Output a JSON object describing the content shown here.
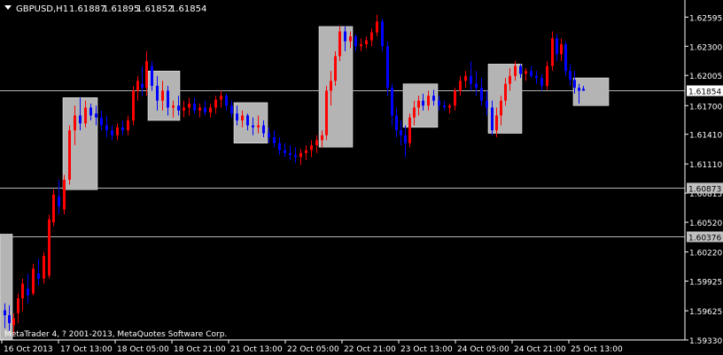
{
  "chart_data": {
    "type": "candlestick",
    "symbol_timeframe": "GBPUSD,H1",
    "ohlc_header": {
      "open": "1.61887",
      "high": "1.61895",
      "low": "1.61852",
      "close": "1.61854"
    },
    "watermark": "MetaTrader 4, ? 2001-2013, MetaQuotes Software Corp.",
    "ylim": [
      1.5933,
      1.6275
    ],
    "y_ticks": [
      "1.62595",
      "1.62300",
      "1.62005",
      "1.61700",
      "1.61410",
      "1.61110",
      "1.60815",
      "1.60520",
      "1.60220",
      "1.59925",
      "1.59625",
      "1.59330"
    ],
    "x_ticks": [
      "16 Oct 2013",
      "17 Oct 13:00",
      "18 Oct 05:00",
      "18 Oct 21:00",
      "21 Oct 13:00",
      "22 Oct 05:00",
      "22 Oct 21:00",
      "23 Oct 13:00",
      "24 Oct 05:00",
      "24 Oct 21:00",
      "25 Oct 13:00"
    ],
    "horizontal_lines": [
      {
        "price": 1.61854,
        "label": "1.61854",
        "kind": "bid"
      },
      {
        "price": 1.60873,
        "label": "1.60873",
        "kind": "level"
      },
      {
        "price": 1.60376,
        "label": "1.60376",
        "kind": "level"
      }
    ],
    "candles": [
      {
        "i": 0,
        "o": 1.5963,
        "h": 1.597,
        "l": 1.5945,
        "c": 1.5958
      },
      {
        "i": 5,
        "o": 1.5958,
        "h": 1.5968,
        "l": 1.5942,
        "c": 1.595
      },
      {
        "i": 10,
        "o": 1.5948,
        "h": 1.596,
        "l": 1.5938,
        "c": 1.5955
      },
      {
        "i": 15,
        "o": 1.596,
        "h": 1.598,
        "l": 1.595,
        "c": 1.5975
      },
      {
        "i": 20,
        "o": 1.5975,
        "h": 1.5995,
        "l": 1.5962,
        "c": 1.599
      },
      {
        "i": 26,
        "o": 1.5985,
        "h": 1.6,
        "l": 1.597,
        "c": 1.5978
      },
      {
        "i": 32,
        "o": 1.598,
        "h": 1.601,
        "l": 1.5978,
        "c": 1.6005
      },
      {
        "i": 38,
        "o": 1.6,
        "h": 1.6015,
        "l": 1.5988,
        "c": 1.5995
      },
      {
        "i": 44,
        "o": 1.5995,
        "h": 1.6022,
        "l": 1.599,
        "c": 1.6018
      },
      {
        "i": 50,
        "o": 1.5998,
        "h": 1.606,
        "l": 1.5995,
        "c": 1.6055
      },
      {
        "i": 55,
        "o": 1.6052,
        "h": 1.6085,
        "l": 1.6048,
        "c": 1.608
      },
      {
        "i": 61,
        "o": 1.6078,
        "h": 1.6095,
        "l": 1.606,
        "c": 1.6068
      },
      {
        "i": 67,
        "o": 1.6065,
        "h": 1.61,
        "l": 1.606,
        "c": 1.6095
      },
      {
        "i": 73,
        "o": 1.6095,
        "h": 1.615,
        "l": 1.609,
        "c": 1.6145
      },
      {
        "i": 79,
        "o": 1.6145,
        "h": 1.617,
        "l": 1.613,
        "c": 1.616
      },
      {
        "i": 85,
        "o": 1.616,
        "h": 1.6178,
        "l": 1.6145,
        "c": 1.6152
      },
      {
        "i": 91,
        "o": 1.6152,
        "h": 1.6175,
        "l": 1.6148,
        "c": 1.6168
      },
      {
        "i": 97,
        "o": 1.6168,
        "h": 1.6172,
        "l": 1.6155,
        "c": 1.616
      },
      {
        "i": 103,
        "o": 1.6162,
        "h": 1.617,
        "l": 1.615,
        "c": 1.6158
      },
      {
        "i": 109,
        "o": 1.6158,
        "h": 1.6165,
        "l": 1.6145,
        "c": 1.615
      },
      {
        "i": 115,
        "o": 1.615,
        "h": 1.616,
        "l": 1.6138,
        "c": 1.6145
      },
      {
        "i": 121,
        "o": 1.6145,
        "h": 1.615,
        "l": 1.6135,
        "c": 1.614
      },
      {
        "i": 127,
        "o": 1.614,
        "h": 1.6152,
        "l": 1.6135,
        "c": 1.6148
      },
      {
        "i": 133,
        "o": 1.6148,
        "h": 1.6155,
        "l": 1.614,
        "c": 1.6145
      },
      {
        "i": 139,
        "o": 1.6145,
        "h": 1.616,
        "l": 1.614,
        "c": 1.6155
      },
      {
        "i": 145,
        "o": 1.6155,
        "h": 1.619,
        "l": 1.615,
        "c": 1.6185
      },
      {
        "i": 150,
        "o": 1.6185,
        "h": 1.62,
        "l": 1.6175,
        "c": 1.6195
      },
      {
        "i": 155,
        "o": 1.6192,
        "h": 1.621,
        "l": 1.618,
        "c": 1.6188
      },
      {
        "i": 160,
        "o": 1.6188,
        "h": 1.6225,
        "l": 1.618,
        "c": 1.6215
      },
      {
        "i": 166,
        "o": 1.621,
        "h": 1.6215,
        "l": 1.6185,
        "c": 1.619
      },
      {
        "i": 172,
        "o": 1.619,
        "h": 1.62,
        "l": 1.6165,
        "c": 1.6175
      },
      {
        "i": 178,
        "o": 1.6175,
        "h": 1.6195,
        "l": 1.6165,
        "c": 1.6185
      },
      {
        "i": 184,
        "o": 1.6185,
        "h": 1.619,
        "l": 1.616,
        "c": 1.6168
      },
      {
        "i": 190,
        "o": 1.6168,
        "h": 1.6175,
        "l": 1.6158,
        "c": 1.617
      },
      {
        "i": 196,
        "o": 1.617,
        "h": 1.618,
        "l": 1.616,
        "c": 1.6165
      },
      {
        "i": 202,
        "o": 1.6165,
        "h": 1.6175,
        "l": 1.6158,
        "c": 1.6168
      },
      {
        "i": 208,
        "o": 1.6168,
        "h": 1.6178,
        "l": 1.616,
        "c": 1.6172
      },
      {
        "i": 214,
        "o": 1.6172,
        "h": 1.6178,
        "l": 1.6162,
        "c": 1.6165
      },
      {
        "i": 220,
        "o": 1.6165,
        "h": 1.6172,
        "l": 1.6158,
        "c": 1.6168
      },
      {
        "i": 226,
        "o": 1.6168,
        "h": 1.6175,
        "l": 1.616,
        "c": 1.6163
      },
      {
        "i": 232,
        "o": 1.6163,
        "h": 1.6172,
        "l": 1.6158,
        "c": 1.6168
      },
      {
        "i": 238,
        "o": 1.6168,
        "h": 1.618,
        "l": 1.6162,
        "c": 1.6176
      },
      {
        "i": 244,
        "o": 1.6176,
        "h": 1.6185,
        "l": 1.6168,
        "c": 1.618
      },
      {
        "i": 250,
        "o": 1.618,
        "h": 1.6182,
        "l": 1.6165,
        "c": 1.617
      },
      {
        "i": 256,
        "o": 1.617,
        "h": 1.6175,
        "l": 1.6158,
        "c": 1.6162
      },
      {
        "i": 262,
        "o": 1.6162,
        "h": 1.617,
        "l": 1.615,
        "c": 1.6155
      },
      {
        "i": 268,
        "o": 1.6155,
        "h": 1.6165,
        "l": 1.6148,
        "c": 1.616
      },
      {
        "i": 274,
        "o": 1.616,
        "h": 1.6162,
        "l": 1.6145,
        "c": 1.615
      },
      {
        "i": 280,
        "o": 1.615,
        "h": 1.6158,
        "l": 1.614,
        "c": 1.6148
      },
      {
        "i": 286,
        "o": 1.6148,
        "h": 1.616,
        "l": 1.6142,
        "c": 1.615
      },
      {
        "i": 292,
        "o": 1.615,
        "h": 1.6155,
        "l": 1.6138,
        "c": 1.6142
      },
      {
        "i": 298,
        "o": 1.6142,
        "h": 1.6148,
        "l": 1.6132,
        "c": 1.6138
      },
      {
        "i": 304,
        "o": 1.6138,
        "h": 1.6145,
        "l": 1.6128,
        "c": 1.6132
      },
      {
        "i": 310,
        "o": 1.6132,
        "h": 1.6138,
        "l": 1.612,
        "c": 1.6125
      },
      {
        "i": 316,
        "o": 1.6125,
        "h": 1.6132,
        "l": 1.6118,
        "c": 1.6122
      },
      {
        "i": 322,
        "o": 1.6122,
        "h": 1.613,
        "l": 1.6115,
        "c": 1.612
      },
      {
        "i": 328,
        "o": 1.612,
        "h": 1.6128,
        "l": 1.6112,
        "c": 1.6118
      },
      {
        "i": 334,
        "o": 1.6118,
        "h": 1.6126,
        "l": 1.611,
        "c": 1.6122
      },
      {
        "i": 340,
        "o": 1.6122,
        "h": 1.613,
        "l": 1.6115,
        "c": 1.6125
      },
      {
        "i": 346,
        "o": 1.6125,
        "h": 1.6135,
        "l": 1.6118,
        "c": 1.613
      },
      {
        "i": 352,
        "o": 1.613,
        "h": 1.614,
        "l": 1.6122,
        "c": 1.6135
      },
      {
        "i": 358,
        "o": 1.6135,
        "h": 1.6145,
        "l": 1.6128,
        "c": 1.614
      },
      {
        "i": 363,
        "o": 1.614,
        "h": 1.619,
        "l": 1.6135,
        "c": 1.6185
      },
      {
        "i": 368,
        "o": 1.6185,
        "h": 1.6205,
        "l": 1.617,
        "c": 1.6195
      },
      {
        "i": 373,
        "o": 1.6195,
        "h": 1.6225,
        "l": 1.619,
        "c": 1.622
      },
      {
        "i": 378,
        "o": 1.622,
        "h": 1.625,
        "l": 1.6215,
        "c": 1.6245
      },
      {
        "i": 384,
        "o": 1.6245,
        "h": 1.625,
        "l": 1.6225,
        "c": 1.6235
      },
      {
        "i": 390,
        "o": 1.6235,
        "h": 1.6245,
        "l": 1.6228,
        "c": 1.624
      },
      {
        "i": 396,
        "o": 1.624,
        "h": 1.6242,
        "l": 1.6225,
        "c": 1.623
      },
      {
        "i": 402,
        "o": 1.623,
        "h": 1.6238,
        "l": 1.6225,
        "c": 1.6232
      },
      {
        "i": 408,
        "o": 1.6232,
        "h": 1.624,
        "l": 1.6228,
        "c": 1.6236
      },
      {
        "i": 414,
        "o": 1.6236,
        "h": 1.6248,
        "l": 1.623,
        "c": 1.6244
      },
      {
        "i": 420,
        "o": 1.6244,
        "h": 1.6262,
        "l": 1.624,
        "c": 1.6255
      },
      {
        "i": 426,
        "o": 1.6255,
        "h": 1.6258,
        "l": 1.6225,
        "c": 1.623
      },
      {
        "i": 432,
        "o": 1.623,
        "h": 1.6235,
        "l": 1.618,
        "c": 1.6188
      },
      {
        "i": 437,
        "o": 1.6188,
        "h": 1.6192,
        "l": 1.615,
        "c": 1.616
      },
      {
        "i": 442,
        "o": 1.616,
        "h": 1.6168,
        "l": 1.6138,
        "c": 1.6145
      },
      {
        "i": 447,
        "o": 1.6145,
        "h": 1.6155,
        "l": 1.613,
        "c": 1.614
      },
      {
        "i": 452,
        "o": 1.614,
        "h": 1.615,
        "l": 1.6118,
        "c": 1.6132
      },
      {
        "i": 457,
        "o": 1.6132,
        "h": 1.6162,
        "l": 1.6128,
        "c": 1.6158
      },
      {
        "i": 462,
        "o": 1.6158,
        "h": 1.6175,
        "l": 1.615,
        "c": 1.6168
      },
      {
        "i": 467,
        "o": 1.6168,
        "h": 1.618,
        "l": 1.616,
        "c": 1.6175
      },
      {
        "i": 472,
        "o": 1.6175,
        "h": 1.6182,
        "l": 1.6165,
        "c": 1.617
      },
      {
        "i": 478,
        "o": 1.617,
        "h": 1.6185,
        "l": 1.6165,
        "c": 1.618
      },
      {
        "i": 484,
        "o": 1.618,
        "h": 1.6186,
        "l": 1.617,
        "c": 1.6175
      },
      {
        "i": 490,
        "o": 1.6175,
        "h": 1.618,
        "l": 1.6165,
        "c": 1.617
      },
      {
        "i": 496,
        "o": 1.617,
        "h": 1.6175,
        "l": 1.6165,
        "c": 1.6168
      },
      {
        "i": 502,
        "o": 1.6168,
        "h": 1.6172,
        "l": 1.6162,
        "c": 1.617
      },
      {
        "i": 508,
        "o": 1.617,
        "h": 1.6188,
        "l": 1.6165,
        "c": 1.6185
      },
      {
        "i": 514,
        "o": 1.6185,
        "h": 1.62,
        "l": 1.618,
        "c": 1.6195
      },
      {
        "i": 520,
        "o": 1.6195,
        "h": 1.6205,
        "l": 1.6188,
        "c": 1.62
      },
      {
        "i": 526,
        "o": 1.62,
        "h": 1.6215,
        "l": 1.6185,
        "c": 1.6192
      },
      {
        "i": 532,
        "o": 1.6192,
        "h": 1.6205,
        "l": 1.618,
        "c": 1.6188
      },
      {
        "i": 538,
        "o": 1.6188,
        "h": 1.6198,
        "l": 1.617,
        "c": 1.6175
      },
      {
        "i": 544,
        "o": 1.6175,
        "h": 1.6185,
        "l": 1.616,
        "c": 1.6168
      },
      {
        "i": 550,
        "o": 1.6168,
        "h": 1.6175,
        "l": 1.614,
        "c": 1.6145
      },
      {
        "i": 555,
        "o": 1.6145,
        "h": 1.6168,
        "l": 1.6138,
        "c": 1.616
      },
      {
        "i": 560,
        "o": 1.616,
        "h": 1.618,
        "l": 1.615,
        "c": 1.6175
      },
      {
        "i": 565,
        "o": 1.6175,
        "h": 1.6198,
        "l": 1.617,
        "c": 1.6192
      },
      {
        "i": 570,
        "o": 1.6192,
        "h": 1.6208,
        "l": 1.6185,
        "c": 1.62
      },
      {
        "i": 576,
        "o": 1.62,
        "h": 1.6215,
        "l": 1.6195,
        "c": 1.621
      },
      {
        "i": 582,
        "o": 1.621,
        "h": 1.6212,
        "l": 1.6198,
        "c": 1.6202
      },
      {
        "i": 588,
        "o": 1.6202,
        "h": 1.6208,
        "l": 1.6195,
        "c": 1.6205
      },
      {
        "i": 594,
        "o": 1.6205,
        "h": 1.621,
        "l": 1.6198,
        "c": 1.62
      },
      {
        "i": 600,
        "o": 1.62,
        "h": 1.6205,
        "l": 1.6192,
        "c": 1.6198
      },
      {
        "i": 606,
        "o": 1.6198,
        "h": 1.6202,
        "l": 1.6185,
        "c": 1.619
      },
      {
        "i": 612,
        "o": 1.619,
        "h": 1.6215,
        "l": 1.6186,
        "c": 1.621
      },
      {
        "i": 618,
        "o": 1.621,
        "h": 1.6245,
        "l": 1.6205,
        "c": 1.6238
      },
      {
        "i": 623,
        "o": 1.6238,
        "h": 1.6242,
        "l": 1.6215,
        "c": 1.6222
      },
      {
        "i": 628,
        "o": 1.6222,
        "h": 1.6238,
        "l": 1.6215,
        "c": 1.6232
      },
      {
        "i": 633,
        "o": 1.6232,
        "h": 1.6235,
        "l": 1.62,
        "c": 1.6205
      },
      {
        "i": 638,
        "o": 1.6205,
        "h": 1.6212,
        "l": 1.619,
        "c": 1.6196
      },
      {
        "i": 643,
        "o": 1.6196,
        "h": 1.6205,
        "l": 1.6182,
        "c": 1.6188
      },
      {
        "i": 648,
        "o": 1.6188,
        "h": 1.6192,
        "l": 1.6172,
        "c": 1.6185
      },
      {
        "i": 653,
        "o": 1.6187,
        "h": 1.619,
        "l": 1.6185,
        "c": 1.6185
      }
    ],
    "boxes": [
      {
        "x0": 0,
        "x1": 14,
        "top": 1.604,
        "bottom": 1.5933
      },
      {
        "x0": 71,
        "x1": 110,
        "top": 1.6178,
        "bottom": 1.6085
      },
      {
        "x0": 167,
        "x1": 203,
        "top": 1.6205,
        "bottom": 1.6155
      },
      {
        "x0": 264,
        "x1": 302,
        "top": 1.6173,
        "bottom": 1.6132
      },
      {
        "x0": 360,
        "x1": 398,
        "top": 1.625,
        "bottom": 1.6128
      },
      {
        "x0": 455,
        "x1": 494,
        "top": 1.6192,
        "bottom": 1.6148
      },
      {
        "x0": 551,
        "x1": 589,
        "top": 1.6212,
        "bottom": 1.6142
      },
      {
        "x0": 647,
        "x1": 687,
        "top": 1.6198,
        "bottom": 1.617
      }
    ]
  }
}
